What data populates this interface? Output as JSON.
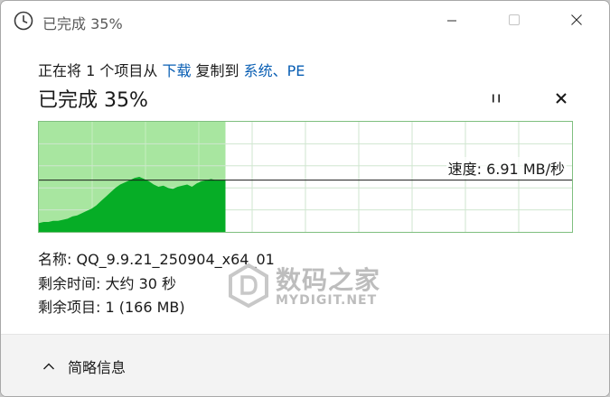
{
  "window": {
    "title": "已完成 35%",
    "icons": {
      "app": "clock-icon",
      "minimize": "minimize-icon",
      "maximize": "maximize-icon",
      "close": "close-icon"
    }
  },
  "copy": {
    "prefix": "正在将 1 个项目从 ",
    "source": "下载",
    "middle": " 复制到 ",
    "destination": "系统、PE"
  },
  "progress": {
    "headline": "已完成 35%",
    "percent": 35,
    "icons": {
      "pause": "pause-icon",
      "stop": "close-icon"
    }
  },
  "speed": {
    "label": "速度: 6.91 MB/秒",
    "value_mb_s": 6.91
  },
  "details": {
    "name": "名称: QQ_9.9.21_250904_x64_01",
    "time_remaining": "剩余时间: 大约 30 秒",
    "items_remaining": "剩余项目: 1 (166 MB)"
  },
  "watermark": {
    "text_cn": "数码之家",
    "text_en": "MYDIGIT.NET"
  },
  "footer": {
    "toggle_label": "简略信息",
    "icon": "chevron-up-icon"
  },
  "colors": {
    "progress_fill": "#a8e6a0",
    "speed_area": "#06ad26",
    "grid": "#cfe6cf",
    "link": "#0a5fb4"
  },
  "chart_data": {
    "type": "area",
    "title": "",
    "xlabel": "",
    "ylabel": "",
    "progress_fraction": 0.35,
    "current_speed_fraction": 0.47,
    "speed_samples": [
      0.08,
      0.09,
      0.09,
      0.1,
      0.1,
      0.11,
      0.12,
      0.14,
      0.15,
      0.17,
      0.19,
      0.21,
      0.24,
      0.28,
      0.32,
      0.36,
      0.4,
      0.43,
      0.45,
      0.47,
      0.49,
      0.5,
      0.48,
      0.46,
      0.43,
      0.41,
      0.42,
      0.4,
      0.39,
      0.41,
      0.42,
      0.43,
      0.41,
      0.44,
      0.46,
      0.47,
      0.48,
      0.47,
      0.47,
      0.47
    ]
  }
}
